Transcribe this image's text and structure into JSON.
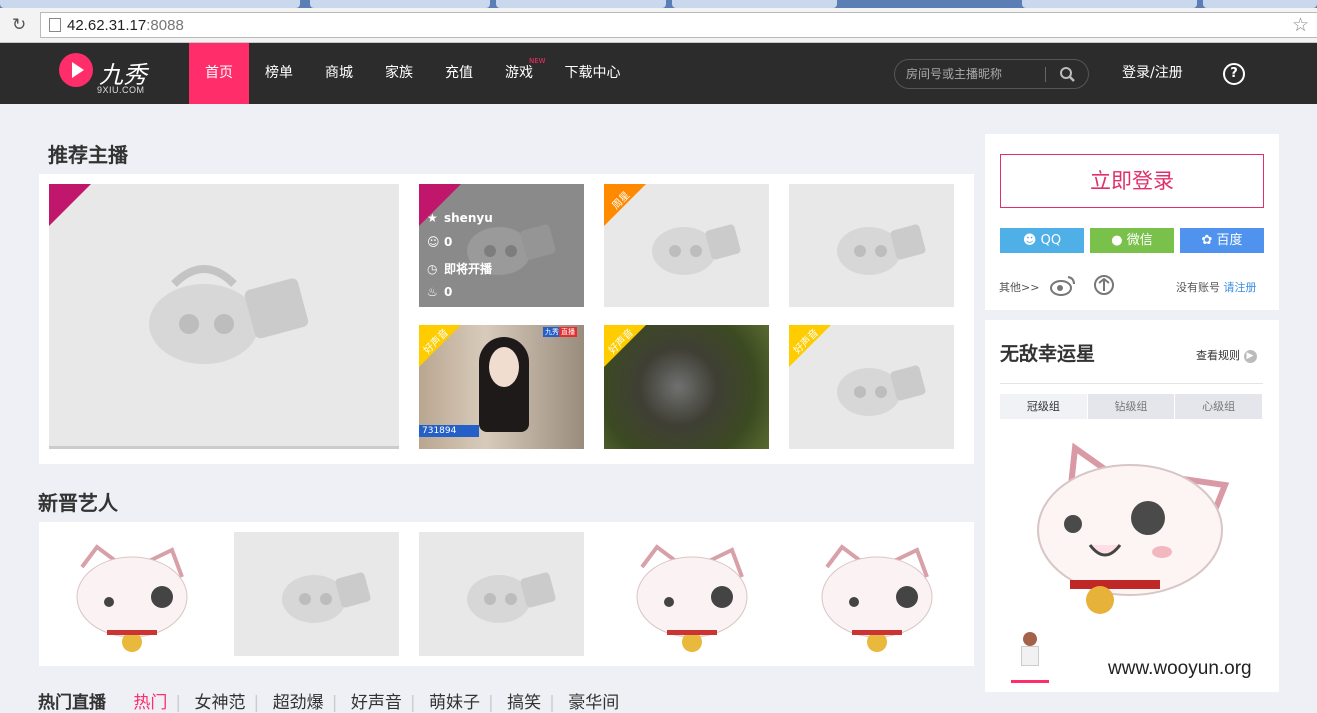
{
  "browser": {
    "url_host": "42.62.31.17",
    "url_port": ":8088"
  },
  "nav": {
    "logo_text": "九秀",
    "logo_sub": "9XIU.COM",
    "items": [
      "首页",
      "榜单",
      "商城",
      "家族",
      "充值",
      "游戏",
      "下载中心"
    ],
    "new_badge": "NEW",
    "search_placeholder": "房间号或主播昵称",
    "login_register": "登录/注册",
    "help": "?"
  },
  "recommended": {
    "title": "推荐主播",
    "hover_card": {
      "name": "shenyu",
      "viewers": "0",
      "status": "即将开播",
      "likes": "0"
    },
    "badges": {
      "weekly_star": "周星",
      "good_voice": "好声音"
    },
    "stream_overlay": {
      "room": "731894",
      "tag_a": "九秀",
      "tag_b": "直播"
    }
  },
  "new_artists": {
    "title": "新晋艺人"
  },
  "hot_live": {
    "title": "热门直播",
    "tabs": [
      "热门",
      "女神范",
      "超劲爆",
      "好声音",
      "萌妹子",
      "搞笑",
      "豪华间"
    ]
  },
  "sidebar": {
    "login_button": "立即登录",
    "social": [
      {
        "label": "QQ",
        "color": "#4fb0e8"
      },
      {
        "label": "微信",
        "color": "#7ac14b"
      },
      {
        "label": "百度",
        "color": "#4f93ee"
      }
    ],
    "others": "其他>>",
    "no_account": "没有账号",
    "register": "请注册",
    "lucky_title": "无敌幸运星",
    "view_rules": "查看规则",
    "groups": [
      "冠级组",
      "钻级组",
      "心级组"
    ]
  },
  "watermark": "www.wooyun.org"
}
